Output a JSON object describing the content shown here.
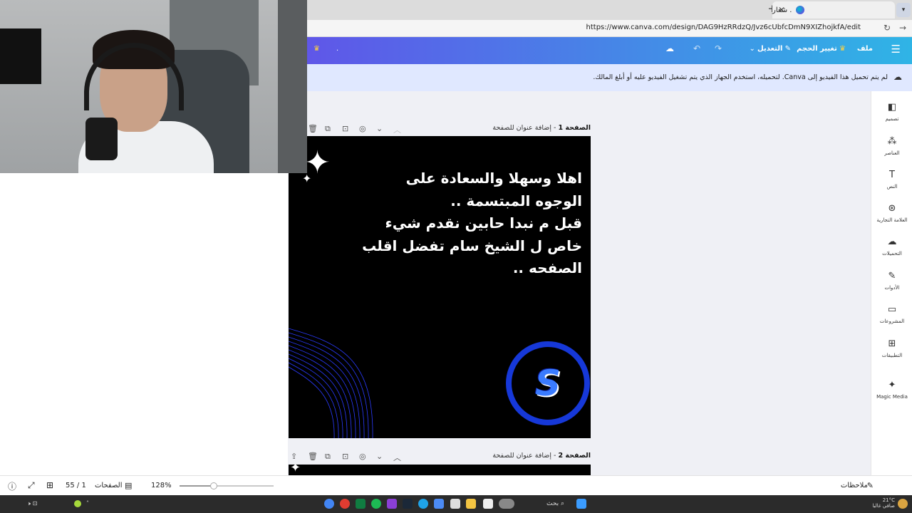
{
  "browser": {
    "tab_title": ". شعار",
    "url": "https://www.canva.com/design/DAG9HzRRdzQ/Jvz6cUbfcDmN9XIZhojkfA/edit"
  },
  "header": {
    "file_label": "ملف",
    "resize_label": "تغيير الحجم",
    "edit_label": "التعديل",
    "left_mark": "."
  },
  "notice": {
    "text": "لم يتم تحميل هذا الفيديو إلى Canva. لتحميله، استخدم الجهاز الذي يتم تشغيل الفيديو عليه أو أبلغ المالك."
  },
  "sidebar": {
    "items": [
      {
        "label": "تصميم",
        "icon": "layout-icon"
      },
      {
        "label": "العناصر",
        "icon": "elements-icon"
      },
      {
        "label": "النص",
        "icon": "text-icon"
      },
      {
        "label": "العلامة التجارية",
        "icon": "brand-icon"
      },
      {
        "label": "التحميلات",
        "icon": "upload-icon"
      },
      {
        "label": "الأدوات",
        "icon": "tools-icon"
      },
      {
        "label": "المشروعات",
        "icon": "folder-icon"
      },
      {
        "label": "التطبيقات",
        "icon": "apps-icon"
      },
      {
        "label": "Magic Media",
        "icon": "magic-media-icon"
      }
    ]
  },
  "pages": [
    {
      "number_label": "الصفحة 1",
      "title_placeholder": "إضافة عنوان للصفحة"
    },
    {
      "number_label": "الصفحة 2",
      "title_placeholder": "إضافة عنوان للصفحة"
    }
  ],
  "canvas": {
    "lines": [
      "اهلا وسهلا والسعادة على",
      "الوجوه المبتسمة ..",
      "قبل م نبدا حابين نقدم شيء",
      "خاص ل الشيخ سام تفضل اقلب",
      "الصفحه .."
    ],
    "logo_letter": "S",
    "colors": {
      "background": "#000000",
      "ring": "#1638d8",
      "arcs": "#2b3bff"
    }
  },
  "bottom": {
    "notes_label": "ملاحظات",
    "zoom": "128%",
    "zoom_fraction": 0.36,
    "pages_label": "الصفحات",
    "page_count": "55 / 1"
  },
  "taskbar": {
    "search_label": "بحث",
    "weather": "21°C",
    "weather_desc": "صافي غالبا"
  }
}
